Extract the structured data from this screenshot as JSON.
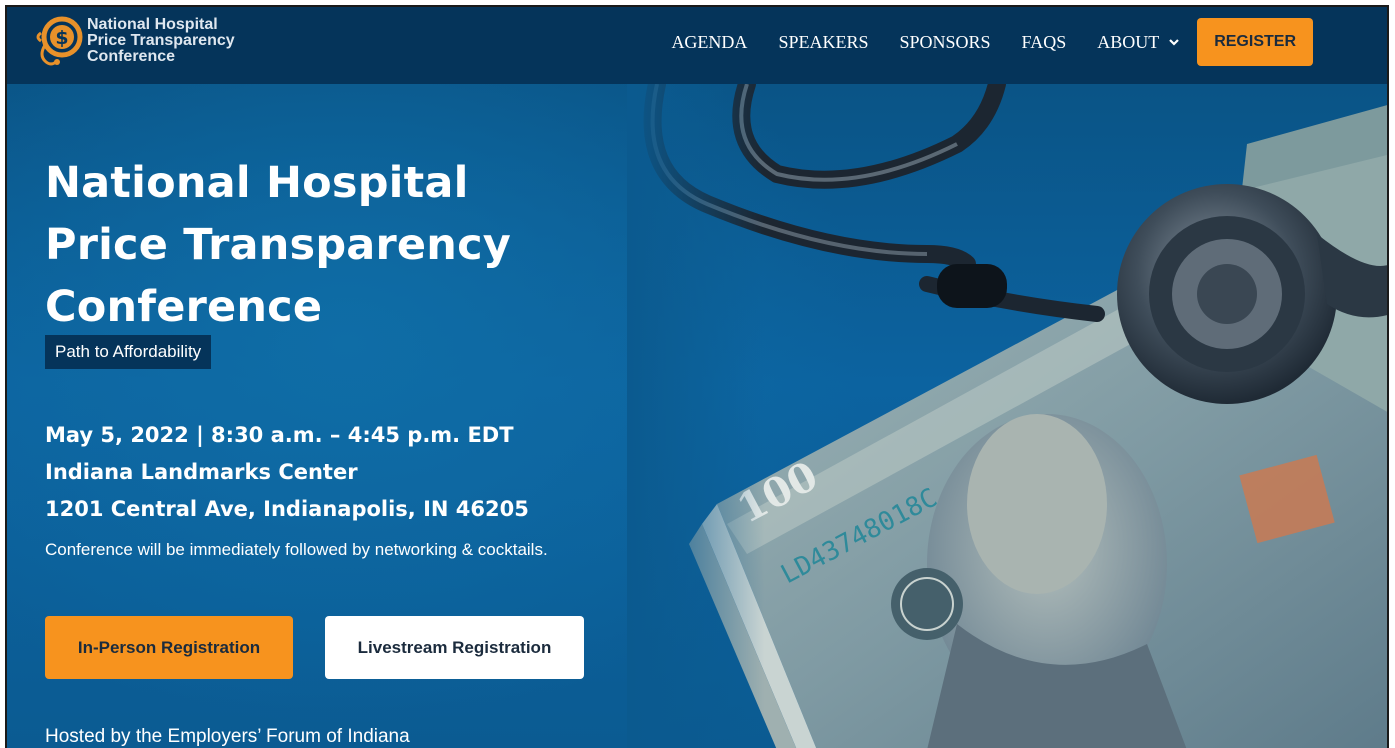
{
  "nav": {
    "logo_lines": [
      "National Hospital",
      "Price Transparency",
      "Conference"
    ],
    "links": [
      "AGENDA",
      "SPEAKERS",
      "SPONSORS",
      "FAQS",
      "ABOUT"
    ],
    "register_label": "REGISTER"
  },
  "hero": {
    "title_lines": [
      "National Hospital",
      "Price Transparency",
      "Conference"
    ],
    "tagline": "Path to Affordability",
    "details": [
      "May 5, 2022 | 8:30 a.m. – 4:45 p.m. EDT",
      "Indiana Landmarks Center",
      "1201 Central Ave, Indianapolis, IN 46205"
    ],
    "note": "Conference will be immediately followed by networking & cocktails.",
    "buttons": {
      "in_person": "In-Person Registration",
      "livestream": "Livestream Registration"
    },
    "hosted_by": "Hosted by the Employers’ Forum of Indiana"
  },
  "colors": {
    "nav_bg": "#05345a",
    "accent": "#f7931e",
    "hero_bg": "#0b5a8f"
  }
}
